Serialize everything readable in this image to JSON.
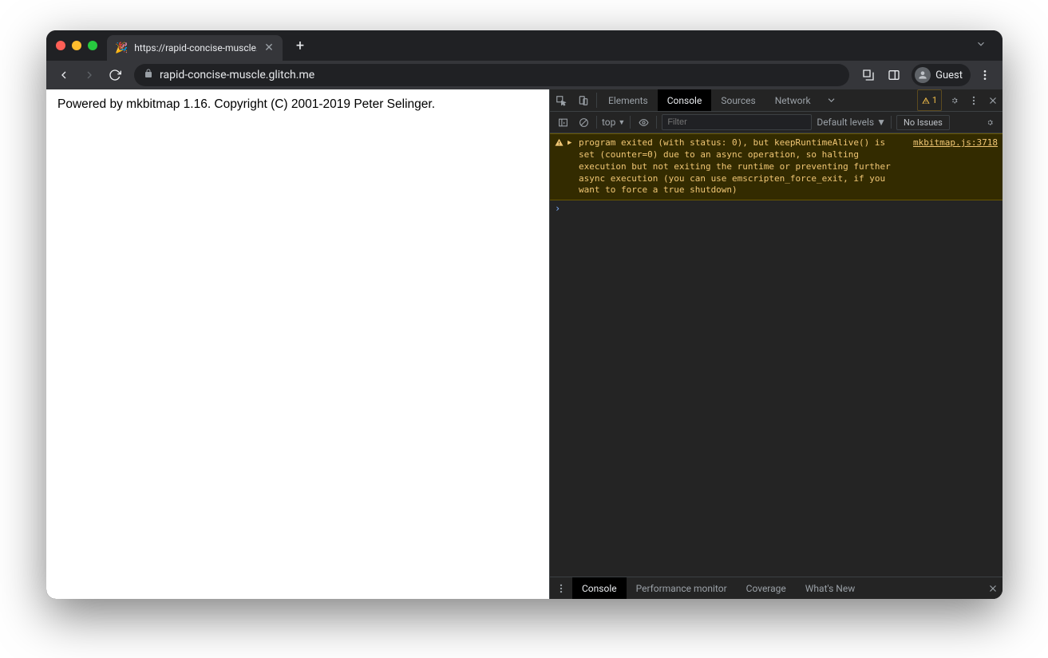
{
  "tab": {
    "favicon": "🎉",
    "title": "https://rapid-concise-muscle.g"
  },
  "omnibox": {
    "url": "rapid-concise-muscle.glitch.me"
  },
  "profile": {
    "label": "Guest"
  },
  "page": {
    "body_text": "Powered by mkbitmap 1.16. Copyright (C) 2001-2019 Peter Selinger."
  },
  "devtools": {
    "tabs": {
      "elements": "Elements",
      "console": "Console",
      "sources": "Sources",
      "network": "Network"
    },
    "warn_count": "1",
    "console_toolbar": {
      "context": "top",
      "filter_placeholder": "Filter",
      "levels": "Default levels",
      "issues": "No Issues"
    },
    "log": {
      "message": "program exited (with status: 0), but keepRuntimeAlive() is set (counter=0) due to an async operation, so halting execution but not exiting the runtime or preventing further async execution (you can use emscripten_force_exit, if you want to force a true shutdown)",
      "source": "mkbitmap.js:3718"
    },
    "drawer": {
      "console": "Console",
      "perf": "Performance monitor",
      "coverage": "Coverage",
      "whatsnew": "What's New"
    }
  }
}
